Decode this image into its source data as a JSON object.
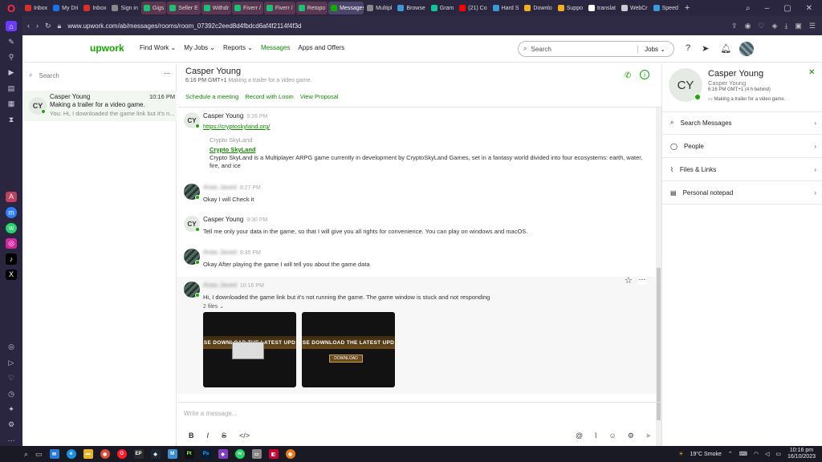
{
  "browser": {
    "tabs": [
      {
        "label": "Inbox",
        "color": "#d93025"
      },
      {
        "label": "My Dri",
        "color": "#1a73e8"
      },
      {
        "label": "Inbox",
        "color": "#d93025"
      },
      {
        "label": "Sign in",
        "color": "#888888"
      },
      {
        "label": "Gigs",
        "color": "#1dbf73"
      },
      {
        "label": "Seller E",
        "color": "#1dbf73"
      },
      {
        "label": "Withdr",
        "color": "#1dbf73"
      },
      {
        "label": "Fiverr /",
        "color": "#1dbf73"
      },
      {
        "label": "Fiverr /",
        "color": "#1dbf73"
      },
      {
        "label": "Retopo",
        "color": "#1dbf73"
      },
      {
        "label": "Messages",
        "color": "#14a800"
      },
      {
        "label": "Multipl",
        "color": "#888888"
      },
      {
        "label": "Browse",
        "color": "#3a9ad9"
      },
      {
        "label": "Gram",
        "color": "#15c39a"
      },
      {
        "label": "(21) Co",
        "color": "#ff0000"
      },
      {
        "label": "Hard S",
        "color": "#3a9ad9"
      },
      {
        "label": "Downlo",
        "color": "#f0b020"
      },
      {
        "label": "Suppo",
        "color": "#f0b020"
      },
      {
        "label": "translat",
        "color": "#ffffff"
      },
      {
        "label": "WebCr",
        "color": "#cccccc"
      },
      {
        "label": "Speed",
        "color": "#3a9ad9"
      }
    ],
    "url": "www.upwork.com/ab/messages/rooms/room_07392c2eed8d4fbdcd6af4f2114f4f3d"
  },
  "header": {
    "logo": "upwork",
    "nav": [
      "Find Work",
      "My Jobs",
      "Reports",
      "Messages",
      "Apps and Offers"
    ],
    "search_placeholder": "Search",
    "search_scope": "Jobs"
  },
  "left": {
    "search_placeholder": "Search",
    "conversation": {
      "initials": "CY",
      "name": "Casper Young",
      "time": "10:16 PM",
      "title": "Making a trailer for a video game.",
      "preview": "You: Hi, I downloaded the game link but it's n..."
    }
  },
  "chat": {
    "name": "Casper Young",
    "local_time": "6:16 PM GMT+1",
    "topic": "Making a trailer for a video game.",
    "links": [
      "Schedule a meeting",
      "Record with Loom",
      "View Proposal"
    ],
    "messages": [
      {
        "sender": "Casper Young",
        "time": "9:26 PM",
        "link": "https://cryptoskyland.org/",
        "preview_site": "Crypto SkyLand",
        "preview_title": "Crypto SkyLand",
        "preview_text": "Crypto SkyLand is a Multiplayer ARPG game currently in development by CryptoSkyLand Games, set in a fantasy world divided into four ecosystems: earth, water, fire, and ice"
      },
      {
        "sender": "Anas Javed",
        "time": "9:27 PM",
        "text": "Okay I will Check it"
      },
      {
        "sender": "Casper Young",
        "time": "9:30 PM",
        "text": "Tell me only your data in the game, so that I will give you all rights for convenience. You can play on windows and macOS."
      },
      {
        "sender": "Anas Javed",
        "time": "9:35 PM",
        "text": "Okay After playing the game I will tell you about the game data"
      },
      {
        "sender": "Anas Javed",
        "time": "10:16 PM",
        "text": "Hi, I downloaded the game link but it's not running the game. The game window is stuck and not responding",
        "files": "2 files",
        "thumb_text": "SE DOWNLOAD THE LATEST UPD",
        "thumb_button": "DOWNLOAD"
      }
    ],
    "compose_placeholder": "Write a message..."
  },
  "profile": {
    "initials": "CY",
    "name": "Casper Young",
    "subname": "Casper Young",
    "time": "6:16 PM GMT+1 (4 h behind)",
    "topic": "Making a trailer for a video game.",
    "items": [
      "Search Messages",
      "People",
      "Files & Links",
      "Personal notepad"
    ]
  },
  "taskbar": {
    "weather": "19°C  Smoke",
    "time": "10:16 pm",
    "date": "16/10/2023"
  }
}
